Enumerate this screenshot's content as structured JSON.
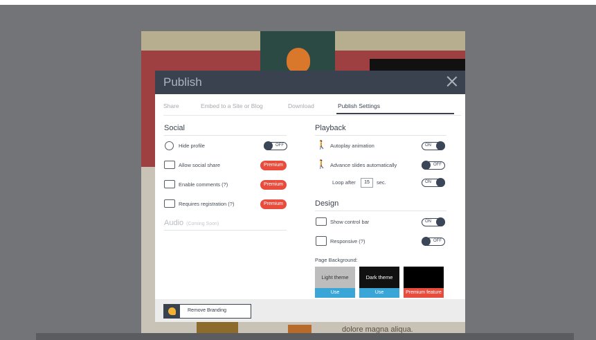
{
  "background": {
    "slide_text": "dolore magna aliqua."
  },
  "modal": {
    "title": "Publish",
    "tabs": [
      {
        "label": "Share"
      },
      {
        "label": "Embed to a Site or Blog"
      },
      {
        "label": "Download"
      },
      {
        "label": "Publish Settings",
        "active": true
      }
    ]
  },
  "social": {
    "title": "Social",
    "rows": [
      {
        "label": "Hide profile",
        "icon": "user-circle-icon",
        "control": "toggle",
        "state": "OFF"
      },
      {
        "label": "Allow social share",
        "icon": "share-icon",
        "control": "premium",
        "badge": "Premium"
      },
      {
        "label": "Enable comments (?)",
        "icon": "comment-icon",
        "control": "premium",
        "badge": "Premium"
      },
      {
        "label": "Requires registration (?)",
        "icon": "form-icon",
        "control": "premium",
        "badge": "Premium"
      }
    ]
  },
  "audio": {
    "title": "Audio",
    "note": "(Coming Soon)"
  },
  "playback": {
    "title": "Playback",
    "rows": [
      {
        "label": "Autoplay animation",
        "icon": "walker-icon",
        "state": "ON"
      },
      {
        "label": "Advance slides automatically",
        "icon": "walker-icon",
        "state": "OFF"
      }
    ],
    "loop": {
      "label_before": "Loop after",
      "value": "15",
      "label_after": "sec.",
      "state": "ON"
    }
  },
  "design": {
    "title": "Design",
    "rows": [
      {
        "label": "Show control bar",
        "icon": "control-bar-icon",
        "state": "ON"
      },
      {
        "label": "Responsive (?)",
        "icon": "responsive-icon",
        "state": "OFF"
      }
    ],
    "page_background_label": "Page Background:",
    "themes": [
      {
        "name": "Light theme",
        "action": "Use",
        "face_color": "#bdbdbd",
        "text_color": "#333333",
        "action_color": "#3aa6d8"
      },
      {
        "name": "Dark theme",
        "action": "Use",
        "face_color": "#111111",
        "text_color": "#ffffff",
        "action_color": "#3aa6d8"
      },
      {
        "name": "",
        "action": "Premium feature",
        "face_color": "#000000",
        "text_color": "#ffffff",
        "action_color": "#e74c3c"
      }
    ]
  },
  "footer": {
    "remove_branding_label": "Remove Branding"
  }
}
